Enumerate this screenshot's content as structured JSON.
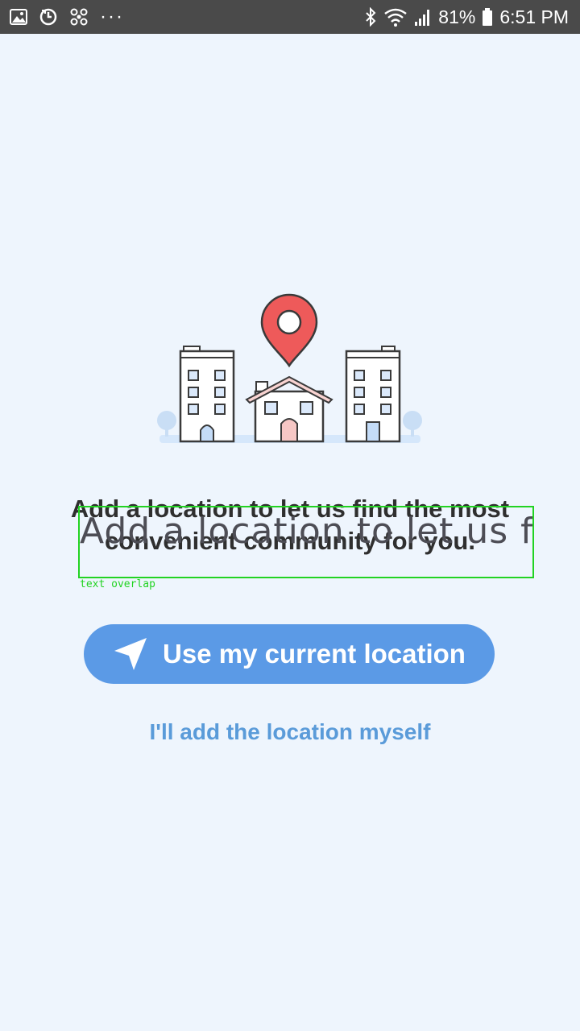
{
  "status_bar": {
    "battery": "81%",
    "time": "6:51 PM",
    "left_icons": [
      "image-icon",
      "sync-icon",
      "fan-icon",
      "more-dots-icon"
    ],
    "right_icons": [
      "bluetooth-icon",
      "wifi-icon",
      "signal-icon",
      "battery-icon"
    ]
  },
  "onboarding": {
    "illustration": "buildings-location-pin-illustration",
    "headline": "Add a location to let us find the most convenient community for you.",
    "primary_button": {
      "label": "Use my current location",
      "icon": "location-arrow-icon"
    },
    "secondary_link": "I'll add the location myself"
  },
  "debug_overlay": {
    "ghost_text": "Add a location to let us fi",
    "label": "text overlap",
    "color": "#22d322"
  },
  "colors": {
    "background": "#eef5fd",
    "status_bar": "#4a4a4a",
    "button": "#5b9ae6",
    "link": "#5a9bd9",
    "pin": "#ee5a5a"
  }
}
